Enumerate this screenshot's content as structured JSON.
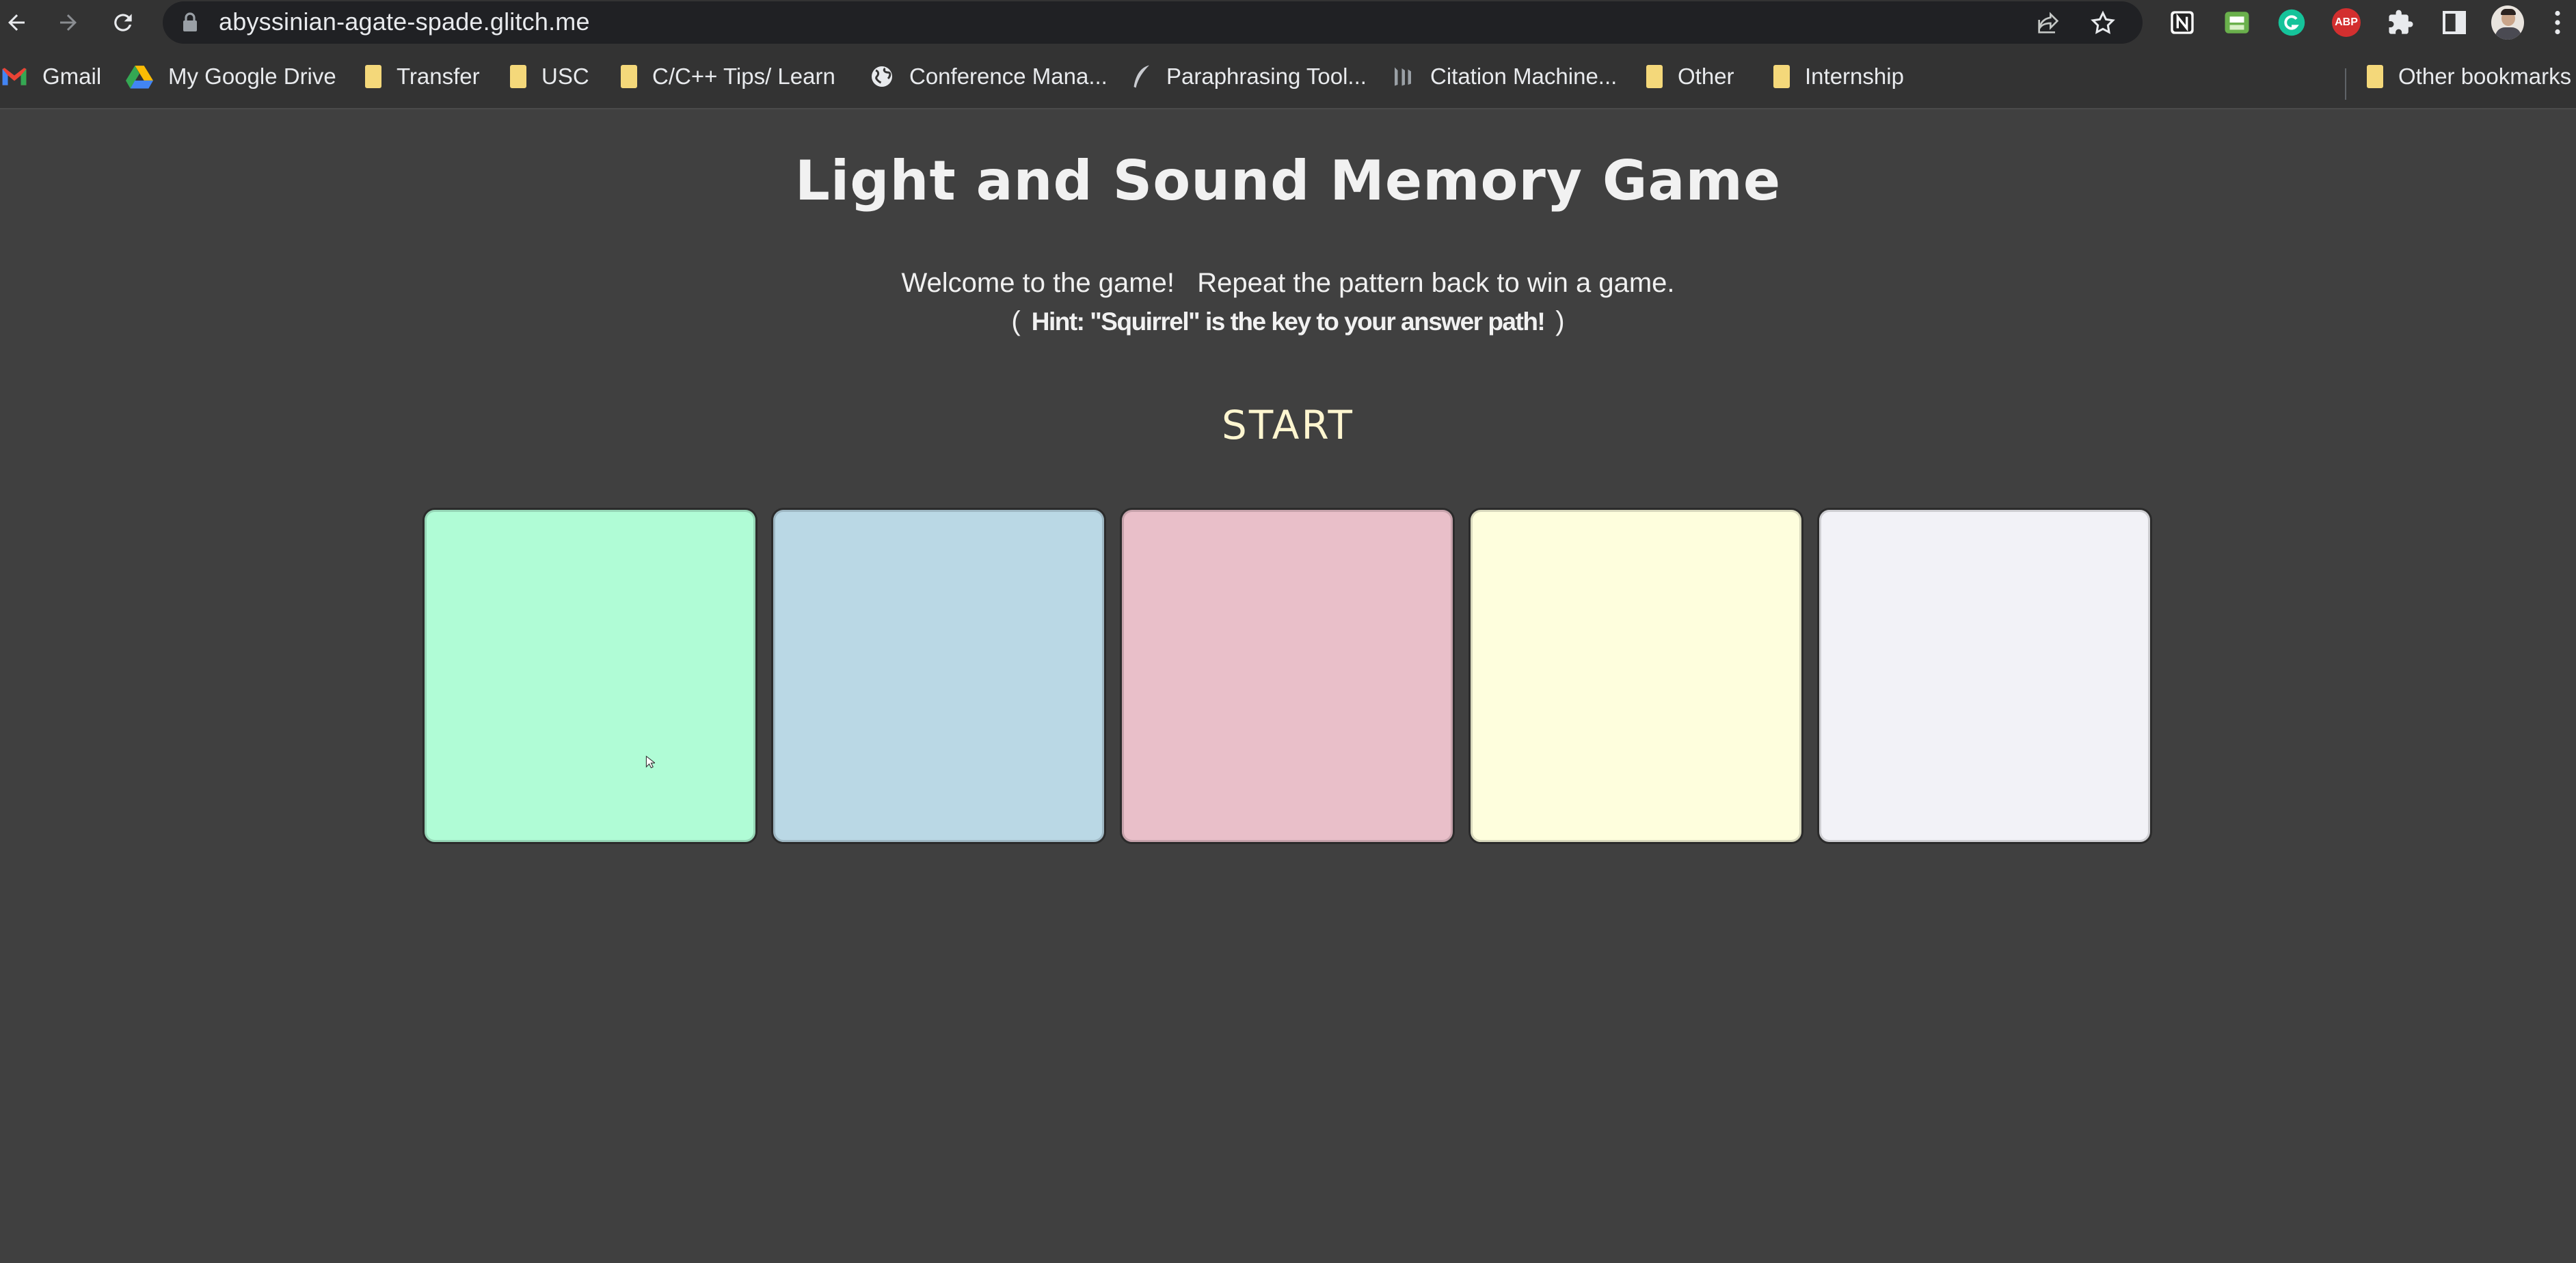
{
  "browser": {
    "url": "abyssinian-agate-spade.glitch.me",
    "bookmarks": [
      {
        "label": "Gmail",
        "icon": "gmail-icon"
      },
      {
        "label": "My Google Drive",
        "icon": "google-drive-icon"
      },
      {
        "label": "Transfer",
        "icon": "folder-icon"
      },
      {
        "label": "USC",
        "icon": "folder-icon"
      },
      {
        "label": "C/C++ Tips/ Learn",
        "icon": "folder-icon"
      },
      {
        "label": "Conference Mana...",
        "icon": "globe-icon"
      },
      {
        "label": "Paraphrasing Tool...",
        "icon": "feather-icon"
      },
      {
        "label": "Citation Machine...",
        "icon": "citation-icon"
      },
      {
        "label": "Other",
        "icon": "folder-icon"
      },
      {
        "label": "Internship",
        "icon": "folder-icon"
      }
    ],
    "other_bookmarks": "Other bookmarks",
    "extensions": {
      "abp_label": "ABP"
    }
  },
  "game": {
    "title": "Light and Sound Memory Game",
    "welcome": "Welcome to the game!   Repeat the pattern back to win a game.",
    "hint_open": "(",
    "hint": "Hint: \"Squirrel\" is the key to your answer path!",
    "hint_close": ")",
    "start_label": "START",
    "pads": [
      {
        "name": "pad-1",
        "color": "#b0fcd6"
      },
      {
        "name": "pad-2",
        "color": "#bad8e5"
      },
      {
        "name": "pad-3",
        "color": "#e9bfc9"
      },
      {
        "name": "pad-4",
        "color": "#fefedd"
      },
      {
        "name": "pad-5",
        "color": "#f2f2f7"
      }
    ]
  }
}
